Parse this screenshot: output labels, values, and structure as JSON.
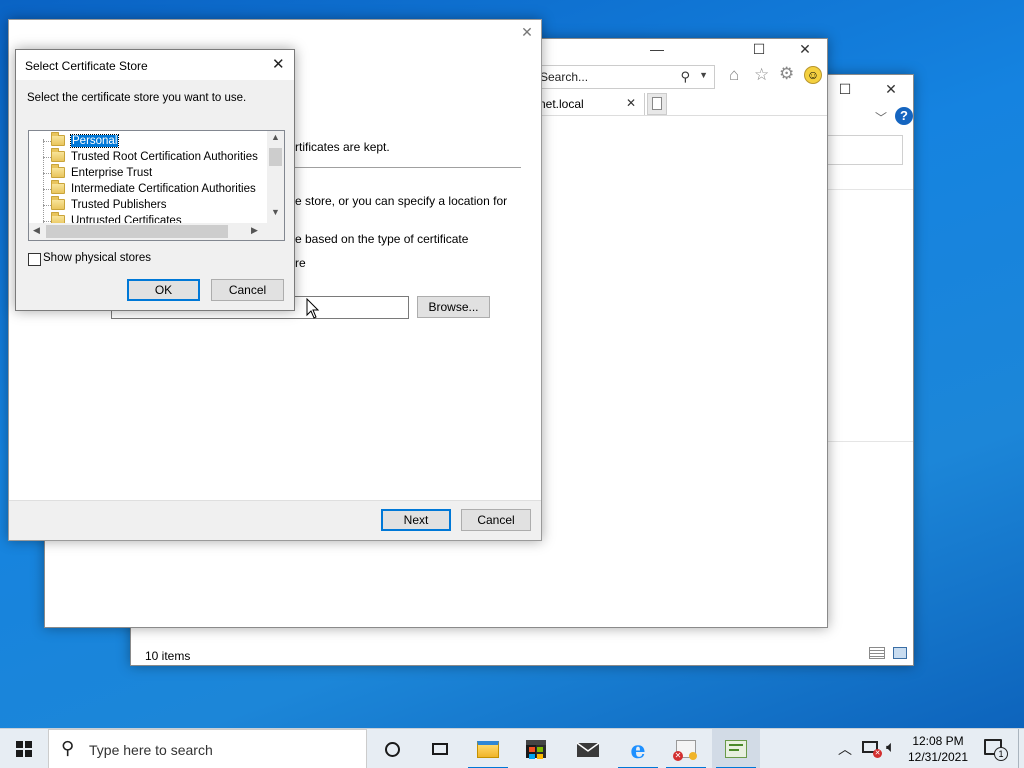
{
  "explorer_window": {
    "status_items": "10 items"
  },
  "ie_window": {
    "search_placeholder": "Search...",
    "tab_label": "net.local"
  },
  "wizard": {
    "partial_line_1": "rtificates are kept.",
    "partial_line_2": "e store, or you can specify a location for",
    "partial_line_3": "e based on the type of certificate",
    "partial_line_4": "re",
    "browse_label": "Browse...",
    "next_label": "Next",
    "cancel_label": "Cancel"
  },
  "dialog": {
    "title": "Select Certificate Store",
    "instruction": "Select the certificate store you want to use.",
    "stores": [
      "Personal",
      "Trusted Root Certification Authorities",
      "Enterprise Trust",
      "Intermediate Certification Authorities",
      "Trusted Publishers",
      "Untrusted Certificates"
    ],
    "selected_store": "Personal",
    "show_physical_label": "Show physical stores",
    "show_physical_checked": false,
    "ok_label": "OK",
    "cancel_label": "Cancel"
  },
  "taskbar": {
    "search_placeholder": "Type here to search",
    "time": "12:08 PM",
    "date": "12/31/2021",
    "notification_count": "1",
    "icons": [
      "windows-start-icon",
      "search-icon",
      "cortana-icon",
      "task-view-icon",
      "file-explorer-icon",
      "store-icon",
      "mail-icon",
      "internet-explorer-icon",
      "certificate-app-icon",
      "certificate-import-icon"
    ]
  },
  "colors": {
    "accent": "#0078d7",
    "selection": "#0078d7",
    "desktop": "#1583e0"
  }
}
